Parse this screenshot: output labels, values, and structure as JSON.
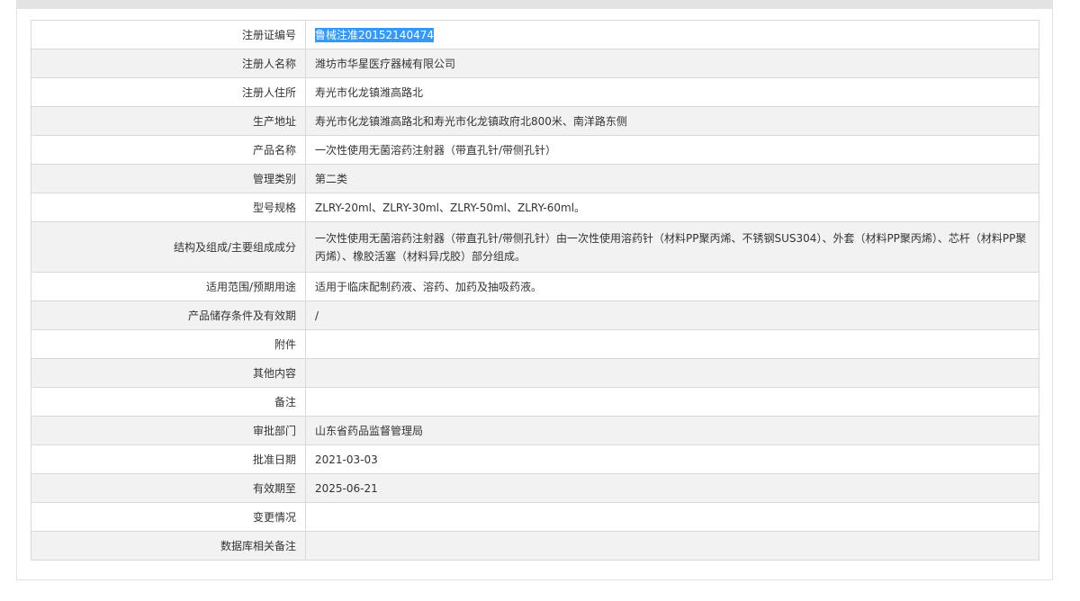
{
  "rows": [
    {
      "label": "注册证编号",
      "value": "鲁械注准20152140474",
      "selected": true
    },
    {
      "label": "注册人名称",
      "value": "潍坊市华星医疗器械有限公司"
    },
    {
      "label": "注册人住所",
      "value": "寿光市化龙镇潍高路北"
    },
    {
      "label": "生产地址",
      "value": "寿光市化龙镇潍高路北和寿光市化龙镇政府北800米、南洋路东侧"
    },
    {
      "label": "产品名称",
      "value": "一次性使用无菌溶药注射器（带直孔针/带侧孔针）"
    },
    {
      "label": "管理类别",
      "value": "第二类"
    },
    {
      "label": "型号规格",
      "value": "ZLRY-20ml、ZLRY-30ml、ZLRY-50ml、ZLRY-60ml。"
    },
    {
      "label": "结构及组成/主要组成成分",
      "value": "一次性使用无菌溶药注射器（带直孔针/带侧孔针）由一次性使用溶药针（材料PP聚丙烯、不锈钢SUS304）、外套（材料PP聚丙烯）、芯杆（材料PP聚丙烯）、橡胶活塞（材料异戊胶）部分组成。"
    },
    {
      "label": "适用范围/预期用途",
      "value": "适用于临床配制药液、溶药、加药及抽吸药液。"
    },
    {
      "label": "产品储存条件及有效期",
      "value": "/"
    },
    {
      "label": "附件",
      "value": ""
    },
    {
      "label": "其他内容",
      "value": ""
    },
    {
      "label": "备注",
      "value": ""
    },
    {
      "label": "审批部门",
      "value": "山东省药品监督管理局"
    },
    {
      "label": "批准日期",
      "value": "2021-03-03"
    },
    {
      "label": "有效期至",
      "value": "2025-06-21"
    },
    {
      "label": "变更情况",
      "value": ""
    },
    {
      "label": "数据库相关备注",
      "value": ""
    }
  ],
  "colors": {
    "selection": "#3399ff",
    "row_alt": "#f2f2f2",
    "border": "#d9d9d9"
  }
}
